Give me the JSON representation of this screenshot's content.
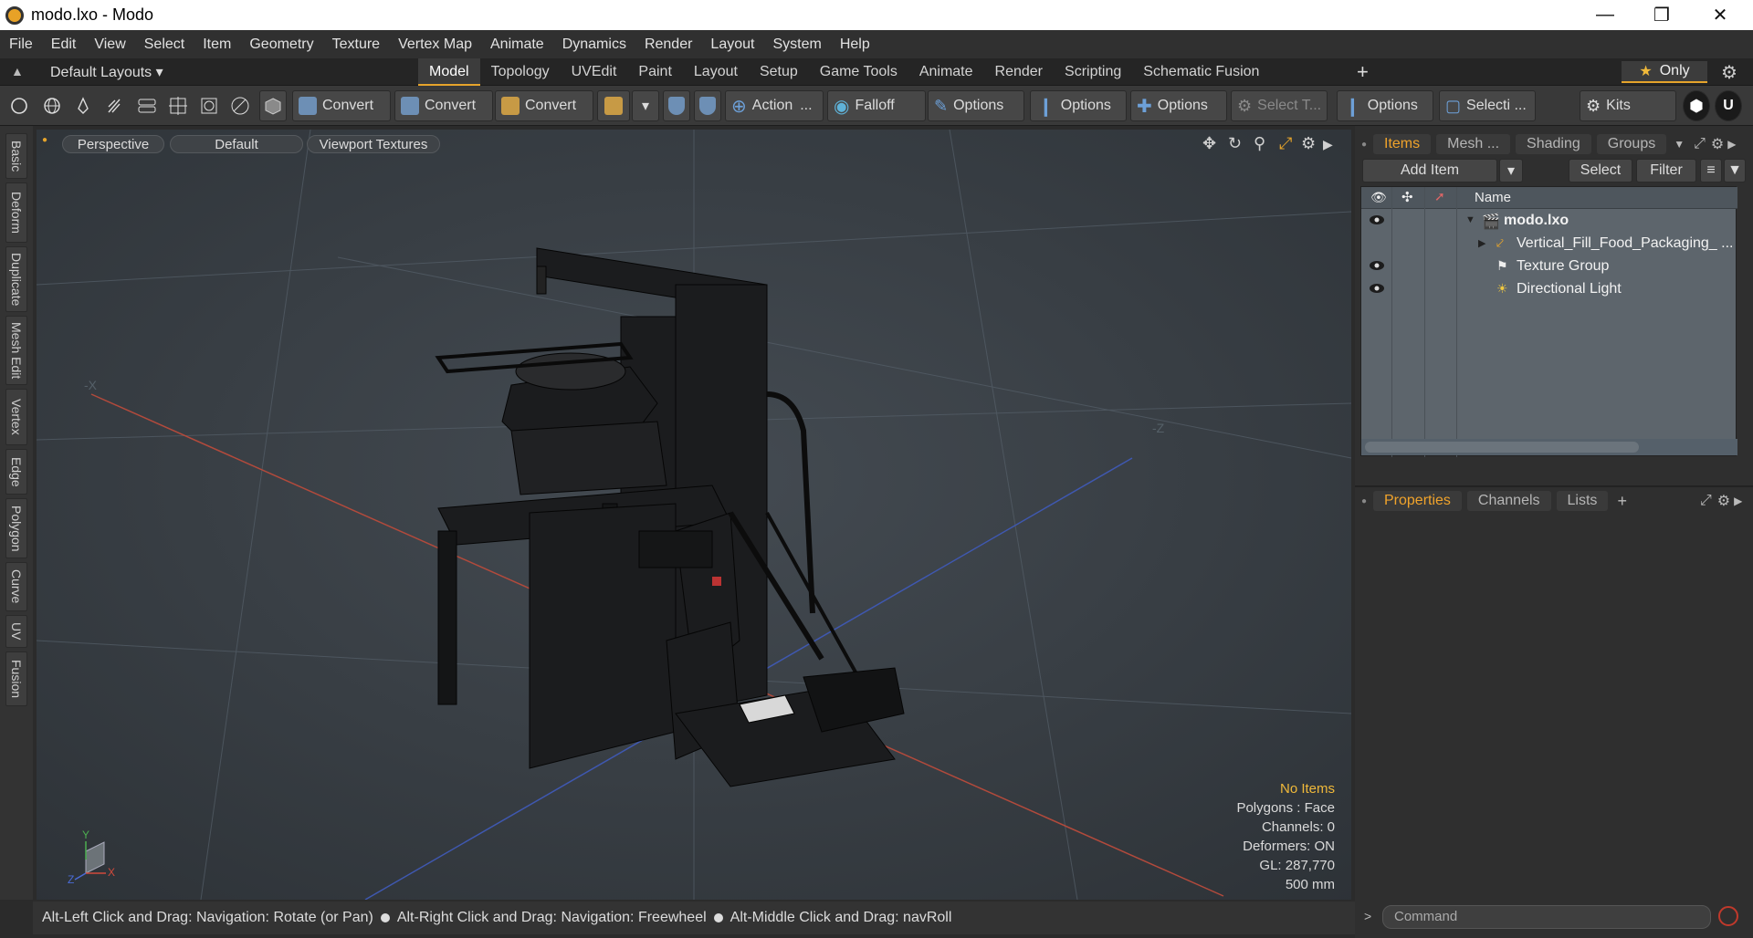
{
  "window": {
    "title": "modo.lxo - Modo",
    "controls": [
      "minimize",
      "restore",
      "close"
    ]
  },
  "menu": [
    "File",
    "Edit",
    "View",
    "Select",
    "Item",
    "Geometry",
    "Texture",
    "Vertex Map",
    "Animate",
    "Dynamics",
    "Render",
    "Layout",
    "System",
    "Help"
  ],
  "layout_bar": {
    "layouts_label": "Default Layouts",
    "tabs": [
      "Model",
      "Topology",
      "UVEdit",
      "Paint",
      "Layout",
      "Setup",
      "Game Tools",
      "Animate",
      "Render",
      "Scripting",
      "Schematic Fusion"
    ],
    "active_tab": "Model",
    "only_label": "Only"
  },
  "toolbar": {
    "convert1": "Convert",
    "convert2": "Convert",
    "convert3": "Convert",
    "action": "Action",
    "action_more": "...",
    "falloff": "Falloff",
    "options1": "Options",
    "options2": "Options",
    "options3": "Options",
    "select_t": "Select T...",
    "options4": "Options",
    "selecti": "Selecti ...",
    "kits": "Kits"
  },
  "left_tabs": [
    "Basic",
    "Deform",
    "Duplicate",
    "Mesh Edit",
    "Vertex",
    "Edge",
    "Polygon",
    "Curve",
    "UV",
    "Fusion"
  ],
  "viewport": {
    "view": "Perspective",
    "style": "Default",
    "textures": "Viewport Textures",
    "axis_neg_x": "-X",
    "axis_neg_z": "-Z",
    "gizmo": {
      "y": "Y",
      "x": "X",
      "z": "Z"
    },
    "stats": {
      "selection": "No Items",
      "polygons": "Polygons : Face",
      "channels": "Channels: 0",
      "deformers": "Deformers: ON",
      "gl": "GL: 287,770",
      "scale": "500 mm"
    }
  },
  "statusbar": {
    "hint1": "Alt-Left Click and Drag: Navigation: Rotate (or Pan)",
    "hint2": "Alt-Right Click and Drag: Navigation: Freewheel",
    "hint3": "Alt-Middle Click and Drag: navRoll"
  },
  "items_panel": {
    "tabs": [
      "Items",
      "Mesh ...",
      "Shading",
      "Groups"
    ],
    "active_tab": "Items",
    "add_item": "Add Item",
    "select": "Select",
    "filter": "Filter",
    "column_name": "Name",
    "rows": [
      {
        "name": "modo.lxo",
        "visible": true,
        "bold": true
      },
      {
        "name": "Vertical_Fill_Food_Packaging_ ...",
        "visible": false,
        "bold": false
      },
      {
        "name": "Texture Group",
        "visible": true,
        "bold": false
      },
      {
        "name": "Directional Light",
        "visible": true,
        "bold": false
      }
    ]
  },
  "properties_panel": {
    "tabs": [
      "Properties",
      "Channels",
      "Lists"
    ],
    "active_tab": "Properties",
    "add_tab": "+"
  },
  "command": {
    "placeholder": "Command",
    "arrow": ">"
  },
  "colors": {
    "accent": "#e6a42b",
    "viewport_bg": "#3a4046",
    "item_list_bg": "#5d656c",
    "x_axis": "#b24a3c",
    "z_axis": "#3f58b0"
  }
}
